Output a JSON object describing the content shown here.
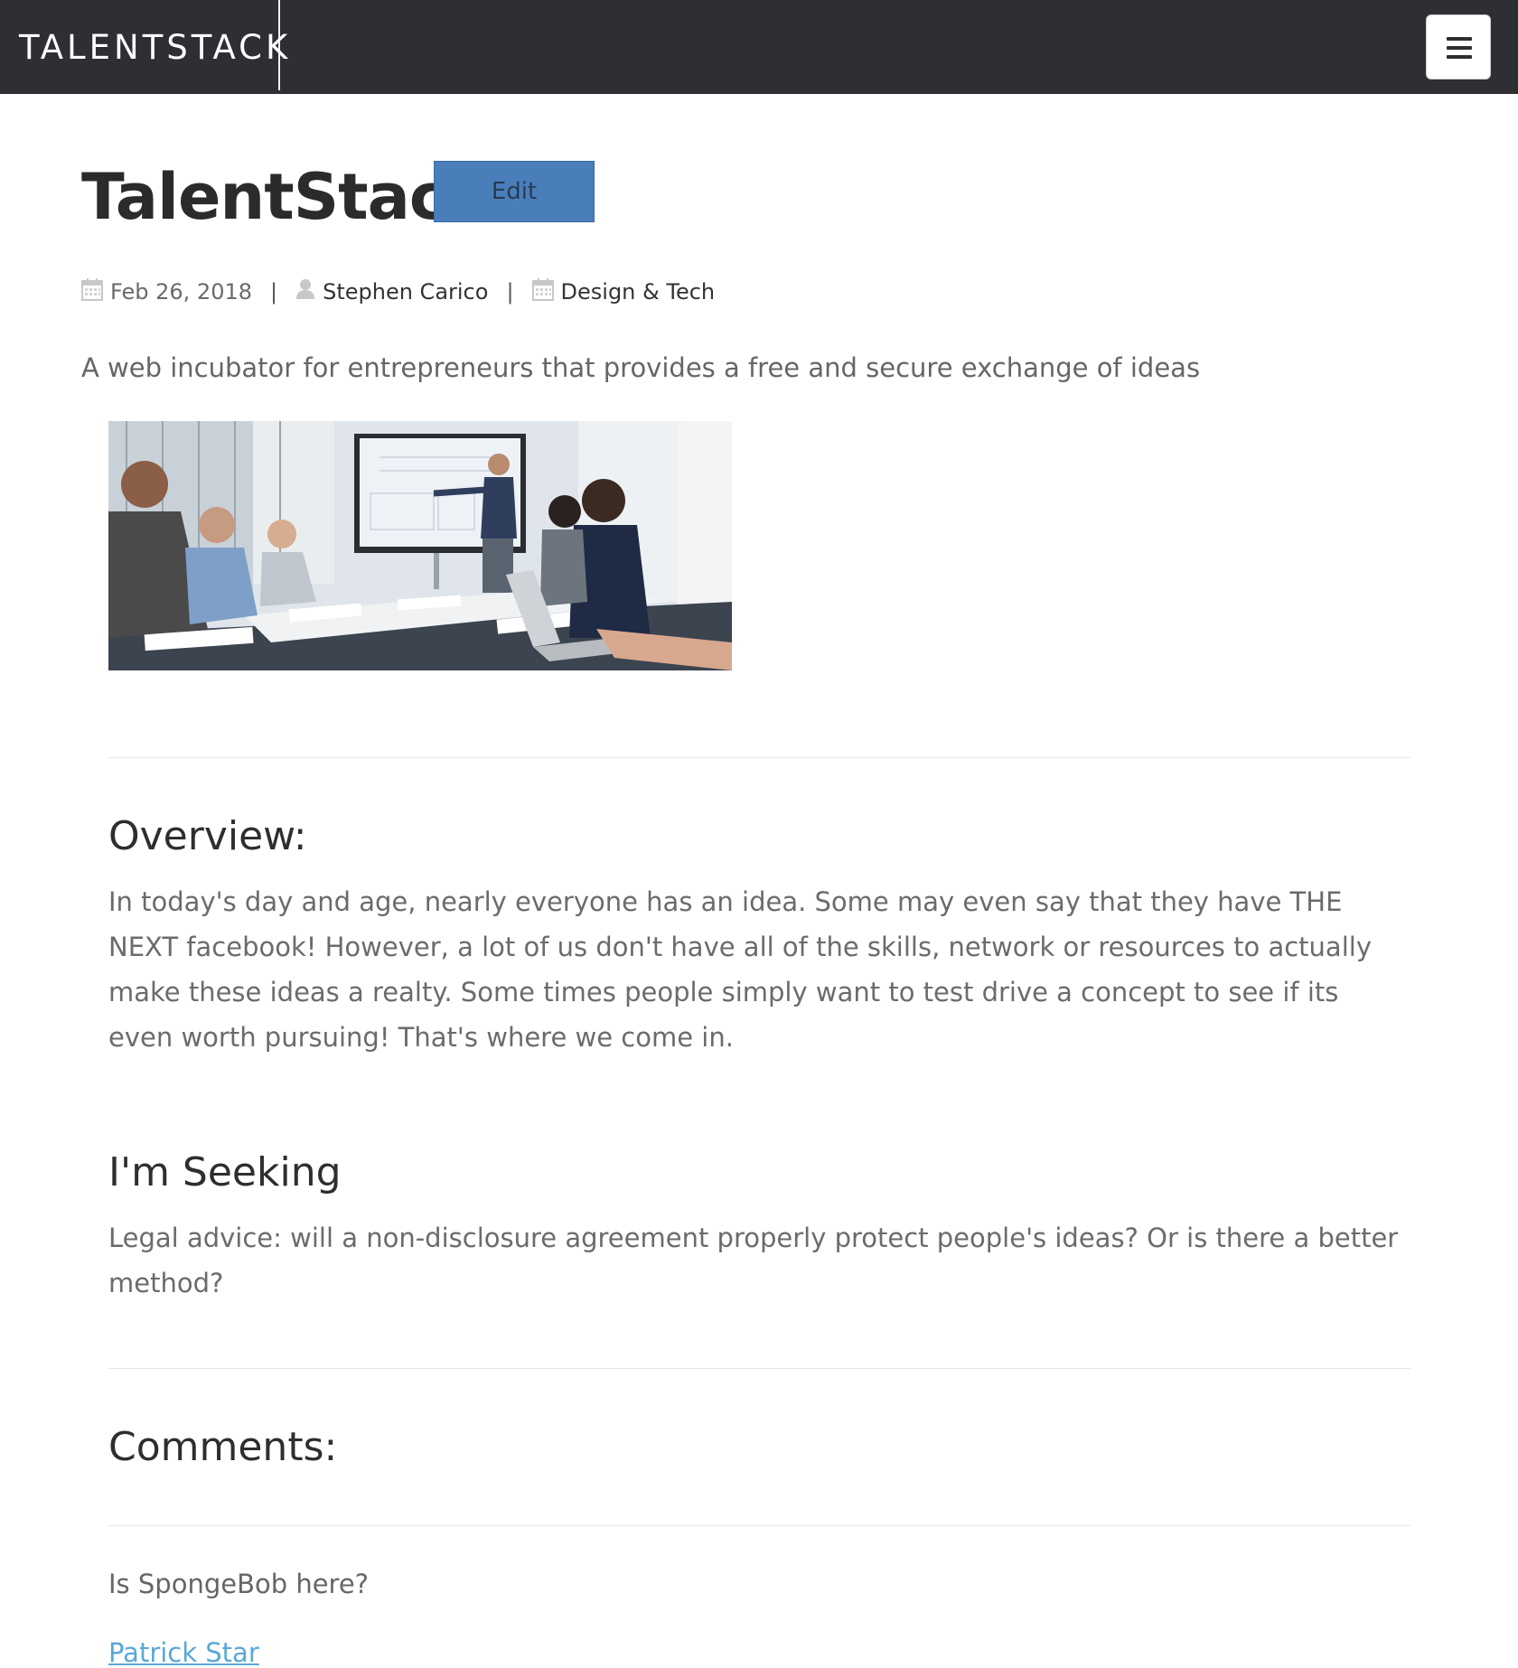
{
  "nav": {
    "brand": "TALENTSTACK",
    "menu_icon": "hamburger-menu-icon"
  },
  "post": {
    "title": "TalentStack",
    "edit_label": "Edit",
    "date": "Feb 26, 2018",
    "author": "Stephen Carico",
    "category": "Design & Tech",
    "meta_separator": "|",
    "summary": "A web incubator for entrepreneurs that provides a free and secure exchange of ideas",
    "image_alt_icon": "meeting-photo"
  },
  "overview": {
    "heading": "Overview:",
    "text": "In today's day and age, nearly everyone has an idea. Some may even say that they have THE NEXT facebook! However, a lot of us don't have all of the skills, network or resources to actually make these ideas a realty. Some times people simply want to test drive a concept to see if its even worth pursuing! That's where we come in."
  },
  "seeking": {
    "heading": "I'm Seeking",
    "text": "Legal advice: will a non-disclosure agreement properly protect people's ideas? Or is there a better method?"
  },
  "comments": {
    "heading": "Comments:",
    "items": [
      {
        "text": "Is SpongeBob here?",
        "author": "Patrick Star"
      }
    ]
  },
  "colors": {
    "navbar": "#2d2f33",
    "edit_button": "#4a7ebb",
    "link": "#5aa7d8"
  }
}
